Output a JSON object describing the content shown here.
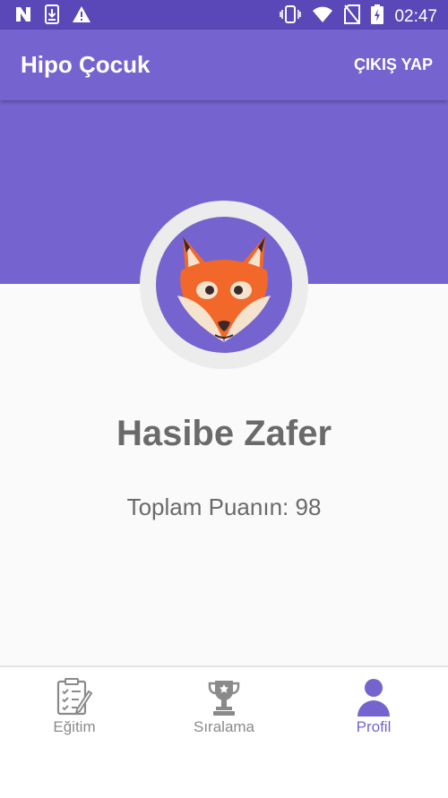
{
  "status_bar": {
    "time": "02:47",
    "icons_left": [
      "n-icon",
      "download-icon",
      "warning-icon"
    ],
    "icons_right": [
      "vibrate-icon",
      "wifi-icon",
      "no-sim-icon",
      "battery-charging-icon"
    ]
  },
  "app_bar": {
    "title": "Hipo Çocuk",
    "logout_label": "ÇIKIŞ YAP"
  },
  "profile": {
    "avatar": "fox-avatar-icon",
    "name": "Hasibe Zafer",
    "score_text": "Toplam Puanın: 98"
  },
  "bottom_nav": {
    "items": [
      {
        "label": "Eğitim",
        "icon": "clipboard-icon",
        "active": false
      },
      {
        "label": "Sıralama",
        "icon": "trophy-icon",
        "active": false
      },
      {
        "label": "Profil",
        "icon": "person-icon",
        "active": true
      }
    ]
  },
  "colors": {
    "primary": "#7564d0",
    "status_bar": "#5a48b8",
    "content_bg": "#fafafa",
    "text_gray": "#6a6a6a",
    "active_nav": "#7564d0"
  }
}
